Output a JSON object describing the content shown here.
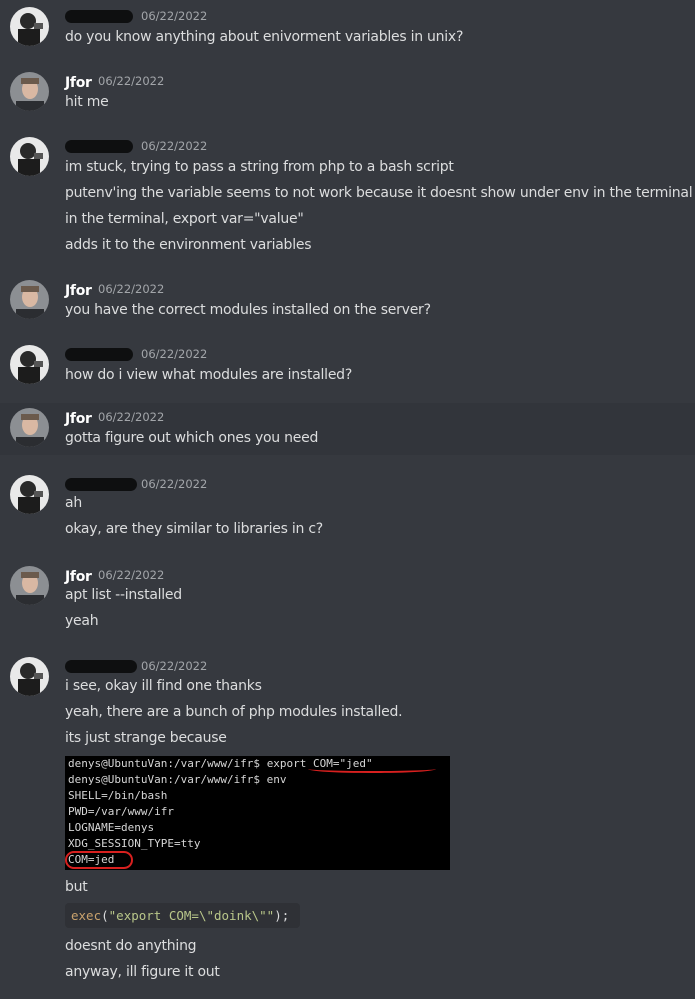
{
  "colors": {
    "background": "#36393f",
    "highlight_row": "#32353b",
    "text": "#dcddde",
    "username": "#ffffff",
    "timestamp": "#a3a6aa",
    "redaction": "#0e0f10",
    "terminal_bg": "#000000",
    "annotation_red": "#d8201f"
  },
  "users": {
    "jfor": "Jfor"
  },
  "messages": [
    {
      "user": "redacted",
      "timestamp": "06/22/2022",
      "lines": [
        "do you know anything about enivorment variables in unix?"
      ]
    },
    {
      "user": "Jfor",
      "timestamp": "06/22/2022",
      "lines": [
        "hit me"
      ]
    },
    {
      "user": "redacted",
      "timestamp": "06/22/2022",
      "lines": [
        "im stuck, trying to pass a string from php to a bash script",
        "putenv'ing the variable seems to not work because it doesnt show under env in the terminal",
        "in the terminal, export var=\"value\"",
        "adds it to the environment variables"
      ]
    },
    {
      "user": "Jfor",
      "timestamp": "06/22/2022",
      "lines": [
        "you have the correct modules installed on the server?"
      ]
    },
    {
      "user": "redacted",
      "timestamp": "06/22/2022",
      "lines": [
        "how do i view what modules are installed?"
      ]
    },
    {
      "user": "Jfor",
      "timestamp": "06/22/2022",
      "lines": [
        "gotta figure out which ones you need"
      ]
    },
    {
      "user": "redacted",
      "timestamp": "06/22/2022",
      "lines": [
        "ah",
        "okay, are they similar to libraries in c?"
      ]
    },
    {
      "user": "Jfor",
      "timestamp": "06/22/2022",
      "lines": [
        "apt list --installed",
        "yeah"
      ]
    },
    {
      "user": "redacted",
      "timestamp": "06/22/2022",
      "lines": [
        "i see, okay ill find one thanks",
        "yeah, there are a bunch of php modules installed.",
        "its just strange because"
      ]
    }
  ],
  "terminal": {
    "prompt1": "denys@UbuntuVan:/var/www/ifr$ ",
    "cmd1": "export COM=\"jed\"",
    "line2": "denys@UbuntuVan:/var/www/ifr$ env",
    "line3": "SHELL=/bin/bash",
    "line4": "PWD=/var/www/ifr",
    "line5": "LOGNAME=denys",
    "line6": "XDG_SESSION_TYPE=tty",
    "line7": "COM=jed"
  },
  "after_terminal": "but",
  "code": {
    "fn": "exec",
    "open": "(",
    "str": "\"export COM=\\\"doink\\\"\"",
    "close": ");"
  },
  "final_lines": [
    "doesnt do anything",
    "anyway, ill figure it out"
  ]
}
